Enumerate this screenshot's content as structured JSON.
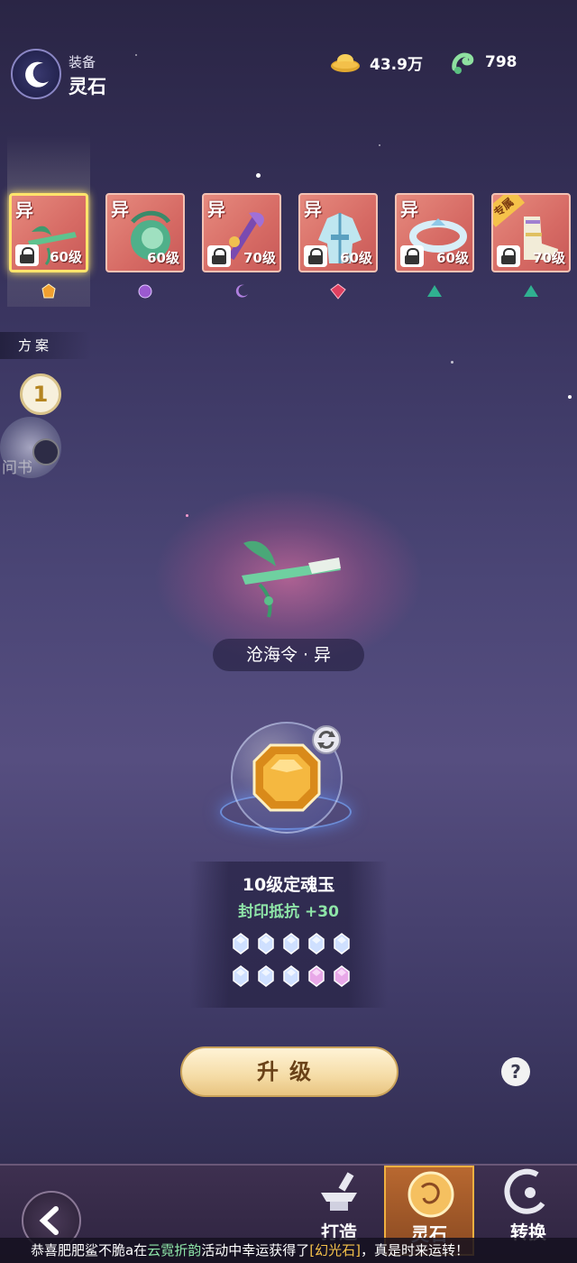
{
  "header": {
    "subtitle": "装备",
    "title": "灵石",
    "gold_amount": "43.9万",
    "jade_amount": "798"
  },
  "slots": [
    {
      "tag": "异",
      "level": "60级",
      "selected": true,
      "gem_color": "#f0a030"
    },
    {
      "tag": "异",
      "level": "60级",
      "selected": false,
      "gem_color": "#9a5ad0"
    },
    {
      "tag": "异",
      "level": "70级",
      "selected": false,
      "gem_color": "#b080e0"
    },
    {
      "tag": "异",
      "level": "60级",
      "selected": false,
      "gem_color": "#e04060"
    },
    {
      "tag": "异",
      "level": "60级",
      "selected": false,
      "gem_color": "#30b090"
    },
    {
      "tag": "异",
      "level": "70级",
      "selected": false,
      "exclusive": "专属",
      "gem_color": "#30b090"
    }
  ],
  "plan": {
    "label": "方案",
    "number": "1",
    "avatar_text": "问书"
  },
  "item": {
    "name": "沧海令 · 异"
  },
  "gem": {
    "title": "10级定魂玉",
    "attribute": "封印抵抗 +30",
    "crystals_row1": [
      "blue",
      "blue",
      "blue",
      "blue",
      "blue"
    ],
    "crystals_row2": [
      "blue",
      "blue",
      "blue",
      "pink",
      "pink"
    ]
  },
  "actions": {
    "upgrade_label": "升级",
    "help_label": "?"
  },
  "tabs": [
    {
      "label": "打造",
      "active": false
    },
    {
      "label": "灵石",
      "active": true
    },
    {
      "label": "转换",
      "active": false
    }
  ],
  "ticker": {
    "prefix": "恭喜肥肥鲨不脆a在",
    "event": "云霓折韵",
    "middle": "活动中幸运获得了",
    "reward": "[幻光石]",
    "suffix": "，真是时来运转！"
  },
  "colors": {
    "slot_red": "#d66a64",
    "selected_border": "#ffe46b",
    "attribute_green": "#8ee5a8",
    "upgrade_gold": "#f5dca6"
  }
}
